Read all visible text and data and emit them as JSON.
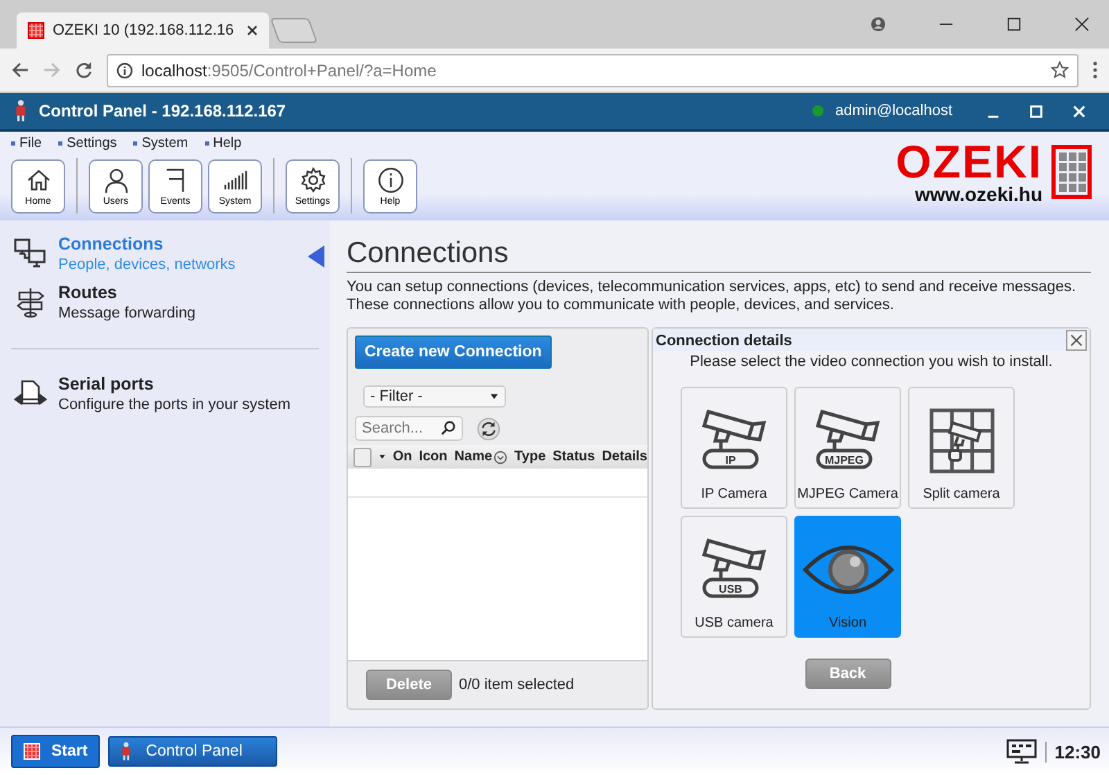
{
  "browser": {
    "tab_title": "OZEKI 10 (192.168.112.16",
    "url_host": "localhost",
    "url_rest": ":9505/Control+Panel/?a=Home"
  },
  "app": {
    "title": "Control Panel - 192.168.112.167",
    "user": "admin@localhost"
  },
  "menu": [
    "File",
    "Settings",
    "System",
    "Help"
  ],
  "toolbar": [
    [
      {
        "label": "Home",
        "kind": "home"
      }
    ],
    [
      {
        "label": "Users",
        "kind": "user"
      },
      {
        "label": "Events",
        "kind": "flag"
      },
      {
        "label": "System",
        "kind": "bars"
      }
    ],
    [
      {
        "label": "Settings",
        "kind": "gear"
      }
    ],
    [
      {
        "label": "Help",
        "kind": "info"
      }
    ]
  ],
  "logo": {
    "name": "OZEKI",
    "url": "www.ozeki.hu"
  },
  "sidebar": [
    [
      {
        "title": "Connections",
        "subtitle": "People, devices, networks",
        "kind": "monitors",
        "selected": true
      },
      {
        "title": "Routes",
        "subtitle": "Message forwarding",
        "kind": "signpost",
        "selected": false
      }
    ],
    [
      {
        "title": "Serial ports",
        "subtitle": "Configure the ports in your system",
        "kind": "serial",
        "selected": false
      }
    ]
  ],
  "page": {
    "title": "Connections",
    "description": "You can setup connections (devices, telecommunication services, apps, etc) to send and receive messages. These connections allow you to communicate with people, devices, and services."
  },
  "list_panel": {
    "create_button": "Create new Connection",
    "filter": "- Filter -",
    "search_placeholder": "Search...",
    "select_all_checked": false,
    "columns": [
      {
        "label": "On",
        "sortable": false
      },
      {
        "label": "Icon",
        "sortable": false
      },
      {
        "label": "Name",
        "sortable": true
      },
      {
        "label": "Type",
        "sortable": false
      },
      {
        "label": "Status",
        "sortable": false
      },
      {
        "label": "Details",
        "sortable": false
      }
    ],
    "delete_button": "Delete",
    "selection": "0/0 item selected"
  },
  "details": {
    "title": "Connection details",
    "prompt": "Please select the video connection you wish to install.",
    "options": [
      {
        "label": "IP Camera",
        "kind": "camera",
        "badge": "IP",
        "selected": false
      },
      {
        "label": "MJPEG Camera",
        "kind": "camera",
        "badge": "MJPEG",
        "selected": false
      },
      {
        "label": "Split camera",
        "kind": "split",
        "selected": false
      },
      {
        "label": "USB camera",
        "kind": "camera",
        "badge": "USB",
        "selected": false
      },
      {
        "label": "Vision",
        "kind": "eye",
        "selected": true
      }
    ],
    "back_button": "Back"
  },
  "taskbar": {
    "start": "Start",
    "apps": [
      {
        "label": "Control Panel"
      }
    ],
    "clock": "12:30"
  }
}
